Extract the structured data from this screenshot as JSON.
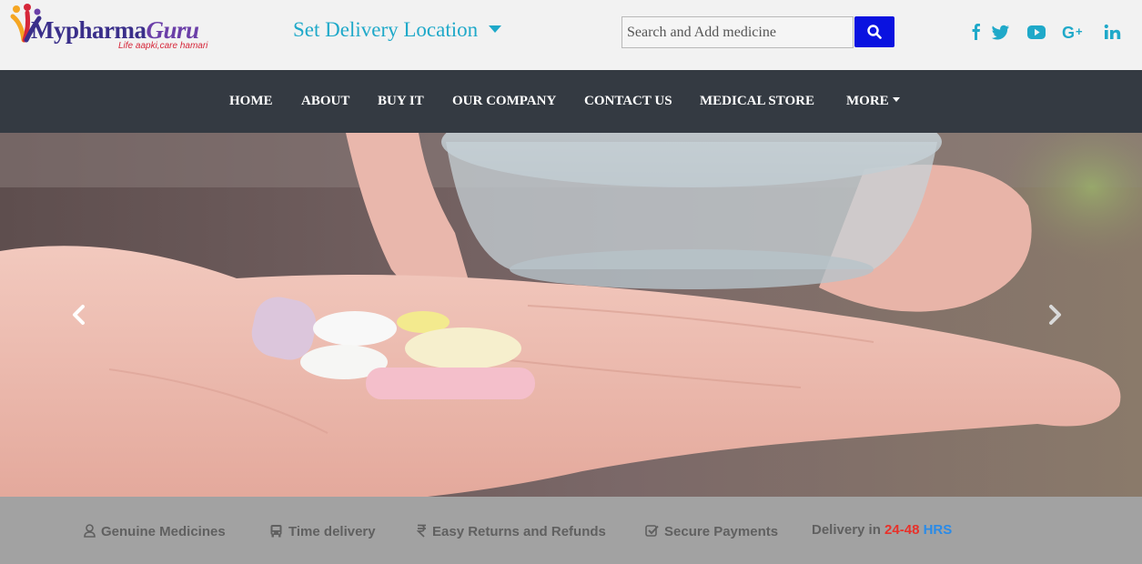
{
  "header": {
    "logo_main": "Mypharma",
    "logo_accent": "Guru",
    "logo_tagline": "Life aapki,care hamari",
    "delivery_location_label": "Set Delivery Location",
    "search": {
      "placeholder": "Search and Add medicine",
      "value": ""
    },
    "social_icons": [
      "facebook-icon",
      "twitter-icon",
      "youtube-icon",
      "google-plus-icon",
      "linkedin-icon"
    ]
  },
  "nav": {
    "items": [
      {
        "label": "HOME"
      },
      {
        "label": "ABOUT"
      },
      {
        "label": "BUY IT"
      },
      {
        "label": "OUR COMPANY"
      },
      {
        "label": "CONTACT US"
      },
      {
        "label": "MEDICAL STORE"
      },
      {
        "label": "MORE"
      }
    ]
  },
  "features": {
    "items": [
      {
        "label": "Genuine Medicines",
        "icon": "user-icon"
      },
      {
        "label": "Time delivery",
        "icon": "bus-icon"
      },
      {
        "label": "Easy Returns and Refunds",
        "icon": "rupee-icon"
      },
      {
        "label": "Secure Payments",
        "icon": "check-square-icon"
      }
    ],
    "delivery_prefix": "Delivery in",
    "delivery_range": "24-48",
    "delivery_unit": "HRS"
  },
  "colors": {
    "accent": "#1fa9c9",
    "nav_bg": "#343a42",
    "search_button": "#0a12e0",
    "feature_strip": "#a2a2a2",
    "hours_range": "#e8312a",
    "hours_unit": "#2a8be8"
  }
}
